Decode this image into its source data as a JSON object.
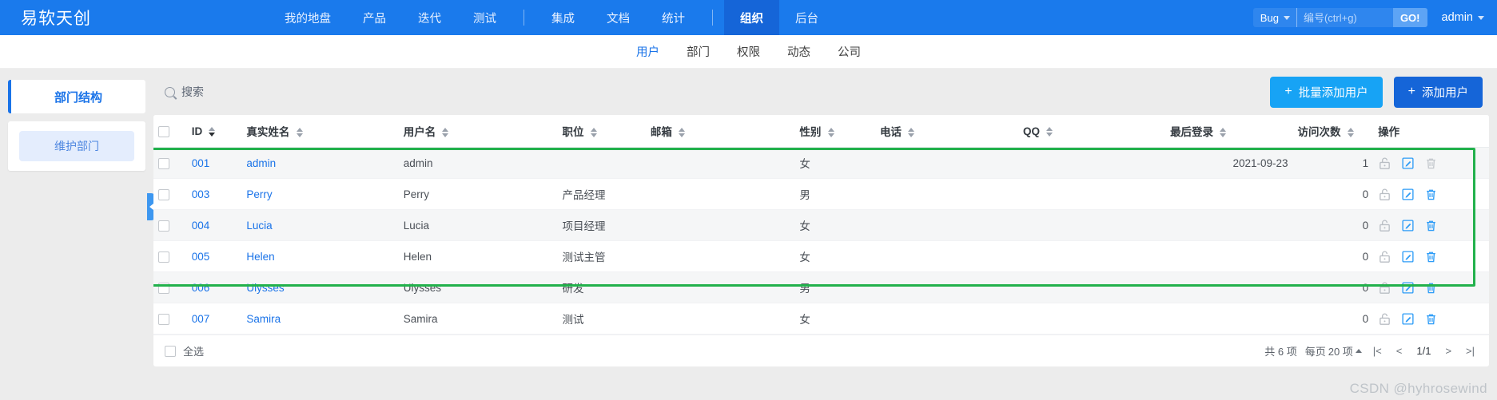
{
  "brand": "易软天创",
  "topnav": {
    "items": [
      {
        "label": "我的地盘",
        "active": false
      },
      {
        "label": "产品",
        "active": false
      },
      {
        "label": "迭代",
        "active": false
      },
      {
        "label": "测试",
        "active": false
      }
    ],
    "items2": [
      {
        "label": "集成",
        "active": false
      },
      {
        "label": "文档",
        "active": false
      },
      {
        "label": "统计",
        "active": false
      }
    ],
    "items3": [
      {
        "label": "组织",
        "active": true
      },
      {
        "label": "后台",
        "active": false
      }
    ],
    "search": {
      "type_label": "Bug",
      "placeholder": "编号(ctrl+g)",
      "value": "",
      "go_label": "GO!"
    },
    "user": "admin"
  },
  "subnav": {
    "items": [
      {
        "label": "用户",
        "active": true
      },
      {
        "label": "部门",
        "active": false
      },
      {
        "label": "权限",
        "active": false
      },
      {
        "label": "动态",
        "active": false
      },
      {
        "label": "公司",
        "active": false
      }
    ]
  },
  "sidebar": {
    "title": "部门结构",
    "maintain_button": "维护部门"
  },
  "toolbar": {
    "search_placeholder": "搜索",
    "batch_add_label": "批量添加用户",
    "add_label": "添加用户",
    "plus": "+"
  },
  "table": {
    "headers": [
      {
        "label": "ID",
        "sortable": true,
        "active": true
      },
      {
        "label": "真实姓名",
        "sortable": true,
        "active": false
      },
      {
        "label": "用户名",
        "sortable": true,
        "active": false
      },
      {
        "label": "职位",
        "sortable": true,
        "active": false
      },
      {
        "label": "邮箱",
        "sortable": true,
        "active": false
      },
      {
        "label": "性别",
        "sortable": true,
        "active": false
      },
      {
        "label": "电话",
        "sortable": true,
        "active": false
      },
      {
        "label": "QQ",
        "sortable": true,
        "active": false
      },
      {
        "label": "最后登录",
        "sortable": true,
        "active": false
      },
      {
        "label": "访问次数",
        "sortable": true,
        "active": false
      },
      {
        "label": "操作",
        "sortable": false,
        "active": false
      }
    ],
    "rows": [
      {
        "id": "001",
        "realname": "admin",
        "username": "admin",
        "position": "",
        "email": "",
        "gender": "女",
        "phone": "",
        "qq": "",
        "lastlogin": "2021-09-23",
        "visits": "1",
        "striped": true,
        "ops_disabled": true
      },
      {
        "id": "003",
        "realname": "Perry",
        "username": "Perry",
        "position": "产品经理",
        "email": "",
        "gender": "男",
        "phone": "",
        "qq": "",
        "lastlogin": "",
        "visits": "0",
        "striped": false,
        "ops_disabled": false
      },
      {
        "id": "004",
        "realname": "Lucia",
        "username": "Lucia",
        "position": "项目经理",
        "email": "",
        "gender": "女",
        "phone": "",
        "qq": "",
        "lastlogin": "",
        "visits": "0",
        "striped": true,
        "ops_disabled": false
      },
      {
        "id": "005",
        "realname": "Helen",
        "username": "Helen",
        "position": "测试主管",
        "email": "",
        "gender": "女",
        "phone": "",
        "qq": "",
        "lastlogin": "",
        "visits": "0",
        "striped": false,
        "ops_disabled": false
      },
      {
        "id": "006",
        "realname": "Ulysses",
        "username": "Ulysses",
        "position": "研发",
        "email": "",
        "gender": "男",
        "phone": "",
        "qq": "",
        "lastlogin": "",
        "visits": "0",
        "striped": true,
        "ops_disabled": false
      },
      {
        "id": "007",
        "realname": "Samira",
        "username": "Samira",
        "position": "测试",
        "email": "",
        "gender": "女",
        "phone": "",
        "qq": "",
        "lastlogin": "",
        "visits": "0",
        "striped": false,
        "ops_disabled": false
      }
    ],
    "ops_icons": [
      "unlock-icon",
      "edit-icon",
      "delete-icon"
    ]
  },
  "footer": {
    "select_all": "全选",
    "total": "共 6 项",
    "per_page_prefix": "每页",
    "per_page_value": "20 项",
    "first": "|<",
    "prev": "<",
    "current": "1/1",
    "next": ">",
    "last": ">|"
  },
  "watermark": "CSDN @hyhrosewind",
  "colors": {
    "brand_blue": "#1a7aec",
    "active_blue": "#1565d8",
    "link_blue": "#1a73e8",
    "light_blue_btn": "#17a3f5",
    "highlight_green": "#22b14c"
  }
}
